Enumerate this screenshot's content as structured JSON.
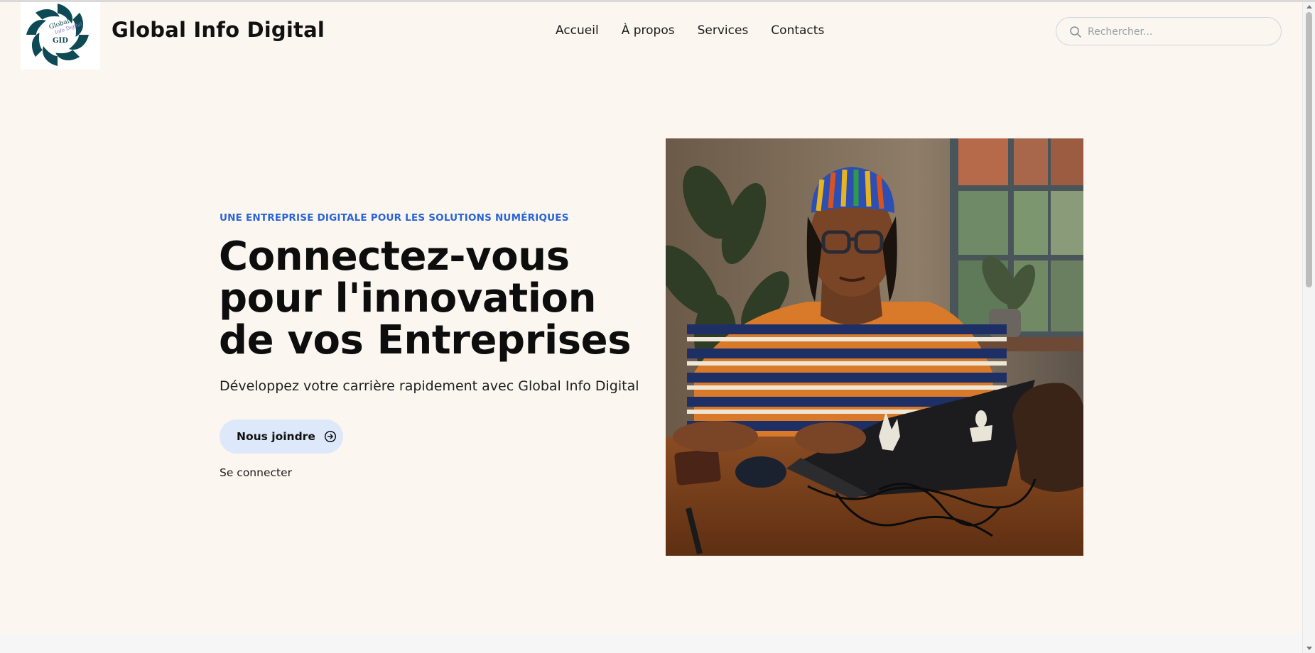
{
  "header": {
    "brand": "Global Info Digital",
    "logo": {
      "text_top": "Global",
      "text_mid": "Info Digital",
      "text_bottom": "GID"
    },
    "nav": [
      "Accueil",
      "À propos",
      "Services",
      "Contacts"
    ],
    "search": {
      "placeholder": "Rechercher...",
      "icon": "search-icon"
    }
  },
  "hero": {
    "eyebrow": "UNE ENTREPRISE DIGITALE POUR LES SOLUTIONS NUMÉRIQUES",
    "headline": "Connectez-vous pour l'innovation de vos Entreprises",
    "subtitle": "Développez votre carrière rapidement avec Global Info Digital",
    "cta_label": "Nous joindre",
    "cta_icon": "arrow-circle-right-icon",
    "login_label": "Se connecter"
  },
  "colors": {
    "background": "#fcf6f0",
    "accent_blue": "#2a64d8",
    "cta_background": "#dde8fb",
    "logo_teal": "#0d4a55"
  }
}
